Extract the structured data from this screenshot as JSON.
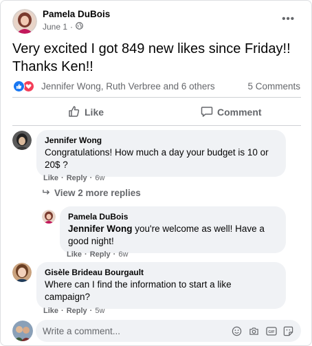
{
  "post": {
    "author": "Pamela DuBois",
    "date": "June 1",
    "separator": "·",
    "text": "Very excited I got 849 new likes since Friday!! Thanks Ken!!",
    "reactions_summary": "Jennifer Wong, Ruth Verbree and 6 others",
    "comments_count": "5 Comments",
    "more_label": "•••"
  },
  "actions": {
    "like": "Like",
    "comment": "Comment"
  },
  "comments": [
    {
      "author": "Jennifer Wong",
      "text": "Congratulations! How much a day your budget is 10 or 20$ ?",
      "like": "Like",
      "reply": "Reply",
      "time": "6w"
    },
    {
      "author": "Gisèle Brideau Bourgault",
      "text": "Where can I find the information to start a like campaign?",
      "like": "Like",
      "reply": "Reply",
      "time": "5w"
    }
  ],
  "view_more": "View 2 more replies",
  "reply": {
    "author": "Pamela DuBois",
    "mention": "Jennifer Wong",
    "text": " you're welcome as well! Have a good night!",
    "like": "Like",
    "reply": "Reply",
    "time": "6w"
  },
  "composer": {
    "placeholder": "Write a comment..."
  },
  "colors": {
    "like_blue": "#1877f2",
    "love_red": "#f33e58",
    "muted": "#65676b",
    "bubble_bg": "#f0f2f5"
  }
}
